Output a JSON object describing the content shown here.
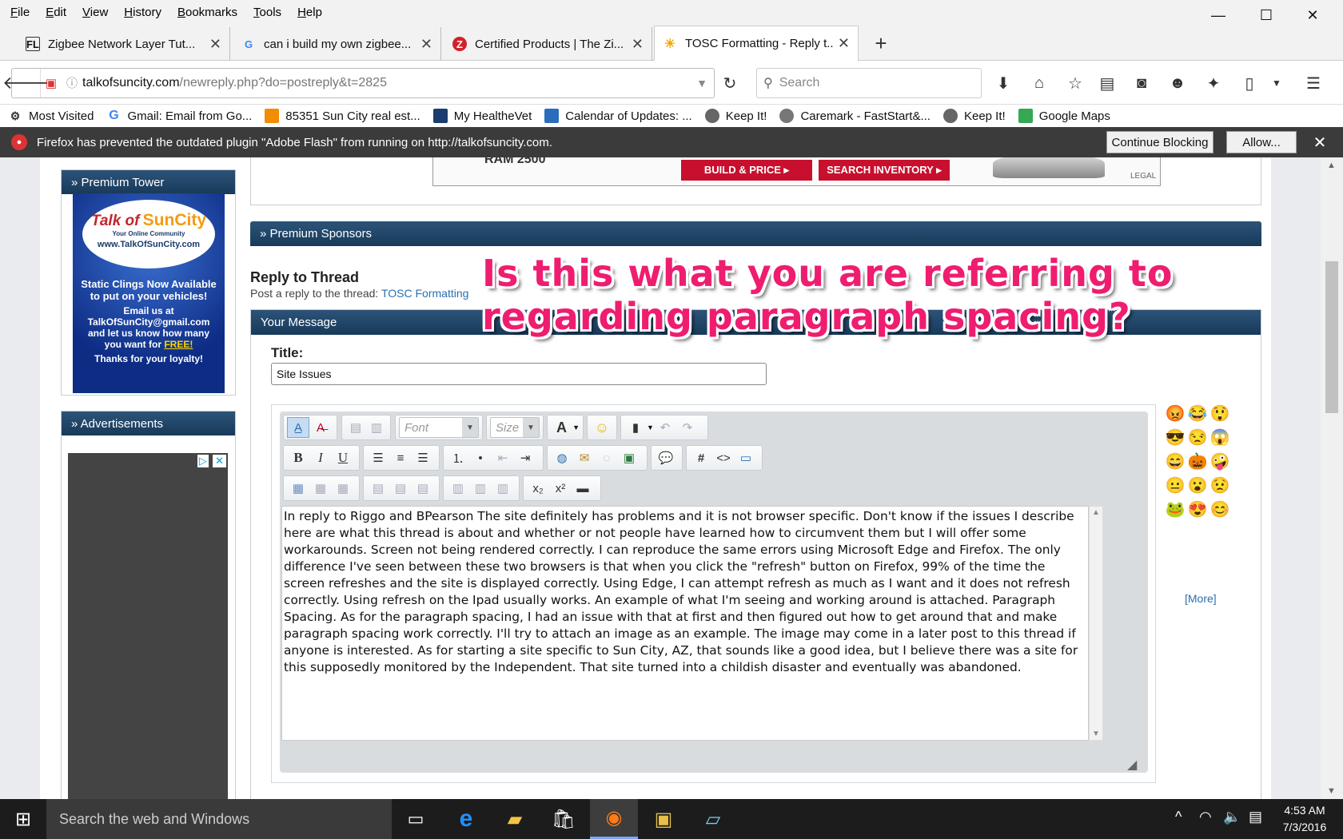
{
  "window": {
    "minimize": "—",
    "maximize": "☐",
    "close": "✕"
  },
  "menubar": [
    "File",
    "Edit",
    "View",
    "History",
    "Bookmarks",
    "Tools",
    "Help"
  ],
  "tabs": [
    {
      "title": "Zigbee Network Layer Tut...",
      "icon": "FL",
      "active": false
    },
    {
      "title": "can i build my own zigbee...",
      "icon": "G",
      "active": false
    },
    {
      "title": "Certified Products | The Zi...",
      "icon": "Z",
      "active": false
    },
    {
      "title": "TOSC Formatting - Reply t...",
      "icon": "☀",
      "active": true
    }
  ],
  "new_tab": "+",
  "nav": {
    "url_host": "talkofsuncity.com",
    "url_path": "/newreply.php?do=postreply&t=2825",
    "search_placeholder": "Search"
  },
  "bookmarks": [
    {
      "label": "Most Visited",
      "color": "#555555"
    },
    {
      "label": "Gmail: Email from Go...",
      "color": "#4285f4",
      "glyph": "G"
    },
    {
      "label": "85351 Sun City real est...",
      "color": "#f28c00"
    },
    {
      "label": "My HealtheVet",
      "color": "#1a3c6e"
    },
    {
      "label": "Calendar of Updates: ...",
      "color": "#2a6ebb"
    },
    {
      "label": "Keep It!",
      "color": "#666666"
    },
    {
      "label": "Caremark - FastStart&...",
      "color": "#777777"
    },
    {
      "label": "Keep It!",
      "color": "#666666"
    },
    {
      "label": "Google Maps",
      "color": "#34a853"
    }
  ],
  "notification": {
    "text": "Firefox has prevented the outdated plugin \"Adobe Flash\" from running on http://talkofsuncity.com.",
    "continue_label": "Continue Blocking",
    "allow_label": "Allow..."
  },
  "banner": {
    "build_label": "BUILD & PRICE ▸",
    "search_label": "SEARCH INVENTORY ▸",
    "legal": "LEGAL",
    "model": "RAM 2500"
  },
  "sidebar": {
    "premium_tower": "» Premium Tower",
    "advertisements": "» Advertisements",
    "ad": {
      "logo_line1": "Talk of",
      "logo_line2": "SunCity",
      "logo_sub": "Your Online Community",
      "site": "www.TalkOfSunCity.com",
      "line1": "Static Clings Now Available",
      "line2": "to put on your vehicles!",
      "line3": "Email us at",
      "line4": "TalkOfSunCity@gmail.com",
      "line5": "and let us know how many",
      "line6a": "you want for ",
      "line6b": "FREE!",
      "line7": "Thanks for your loyalty!"
    }
  },
  "main": {
    "premium_sponsors": "» Premium Sponsors",
    "reply_title": "Reply to Thread",
    "reply_sub": "Post a reply to the thread:",
    "thread_link": "TOSC Formatting",
    "your_message": "Your Message",
    "title_label": "Title:",
    "title_value": "Site Issues",
    "font_placeholder": "Font",
    "size_placeholder": "Size",
    "more_link": "[More]",
    "message": "In reply to Riggo and BPearson The site definitely has problems and it is not browser specific. Don't know if the issues I describe here are what this thread is about and whether or not people have learned how to circumvent them but I will offer some workarounds. Screen not being rendered correctly. I can reproduce the same errors using Microsoft Edge and Firefox. The only difference I've seen between these two browsers is that when you click the \"refresh\" button on Firefox, 99% of the time the screen refreshes and the site is displayed correctly. Using Edge, I can attempt refresh as much as I want and it does not refresh correctly. Using refresh on the Ipad usually works. An example of what I'm seeing and working around is attached. Paragraph Spacing. As for the paragraph spacing, I had an issue with that at first and then figured out how to get around that and make paragraph spacing work correctly. I'll try to attach an image as an example. The image may come in a later post to this thread if anyone is interested. As for starting a site specific to Sun City, AZ, that sounds like a good idea, but I believe there was a site for this supposedly monitored by the Independent. That site turned into a childish disaster and eventually was abandoned."
  },
  "overlay": {
    "line1": "Is this what you are referring to",
    "line2": "regarding paragraph spacing?"
  },
  "taskbar": {
    "search_placeholder": "Search the web and Windows",
    "time": "4:53 AM",
    "date": "7/3/2016"
  },
  "colors": {
    "accent": "#2c5378",
    "overlay": "#ee1d70",
    "link": "#2a6fb0",
    "notify_bg": "#3b3b3b"
  }
}
